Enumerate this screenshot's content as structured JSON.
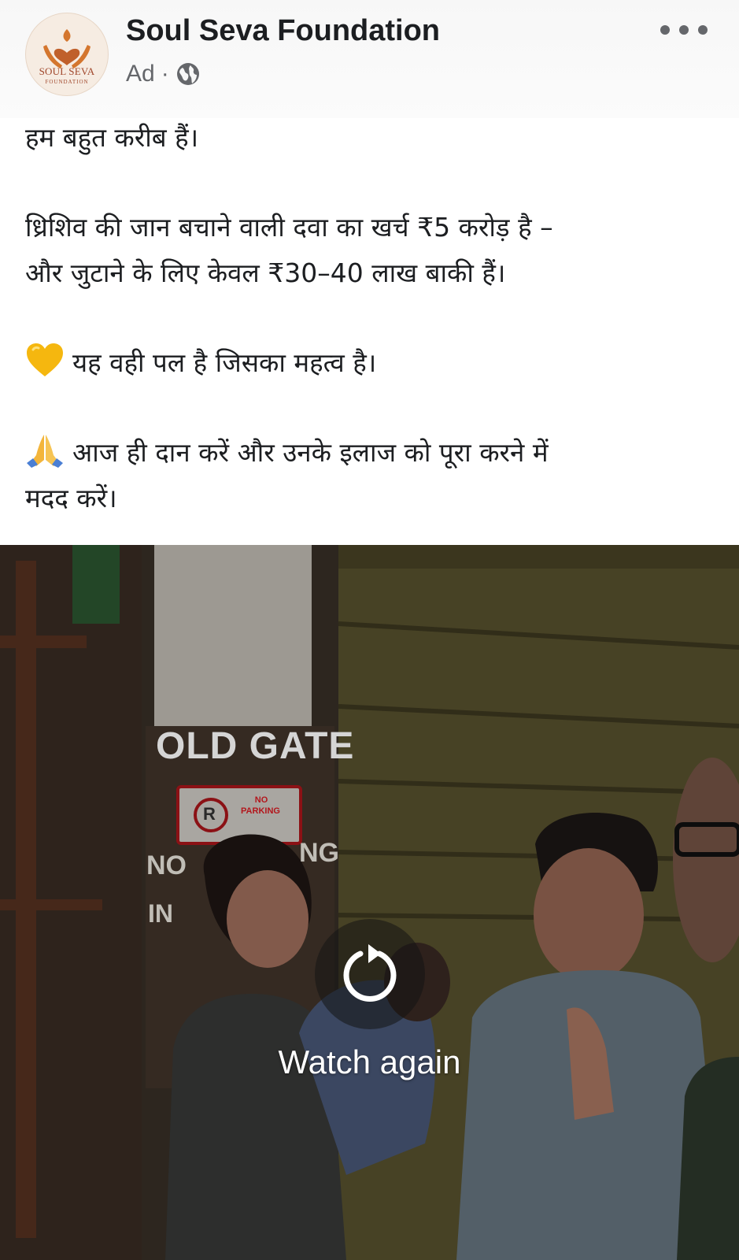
{
  "post": {
    "page_name": "Soul Seva Foundation",
    "sponsored_label": "Ad",
    "separator": "·",
    "audience_icon": "globe-icon",
    "more_icon": "more-horizontal-icon",
    "avatar": {
      "text": "SOUL SEVA",
      "subtext": "FOUNDATION"
    }
  },
  "body": {
    "line1": "हम बहुत करीब हैं।",
    "line2a": "ध्रिशिव की जान बचाने वाली दवा का खर्च ₹5 करोड़ है –",
    "line2b": "और जुटाने के लिए केवल ₹30–40 लाख बाकी हैं।",
    "line3_emoji": "yellow-heart-emoji",
    "line3": "यह वही पल है जिसका महत्व है।",
    "line4_emoji": "folded-hands-emoji",
    "line4a": "आज ही दान करें और उनके इलाज को पूरा करने में",
    "line4b": "मदद करें।"
  },
  "video": {
    "replay_icon": "replay-icon",
    "replay_label": "Watch again",
    "sign_main": "OLD GATE",
    "sign_no": "NO",
    "sign_parking": "PARKING",
    "sign_wall_1": "NO",
    "sign_wall_1b": "NG",
    "sign_wall_2": "IN"
  },
  "colors": {
    "text": "#1c1e21",
    "secondary_text": "#65676b",
    "brand_accent": "#c0602b"
  }
}
